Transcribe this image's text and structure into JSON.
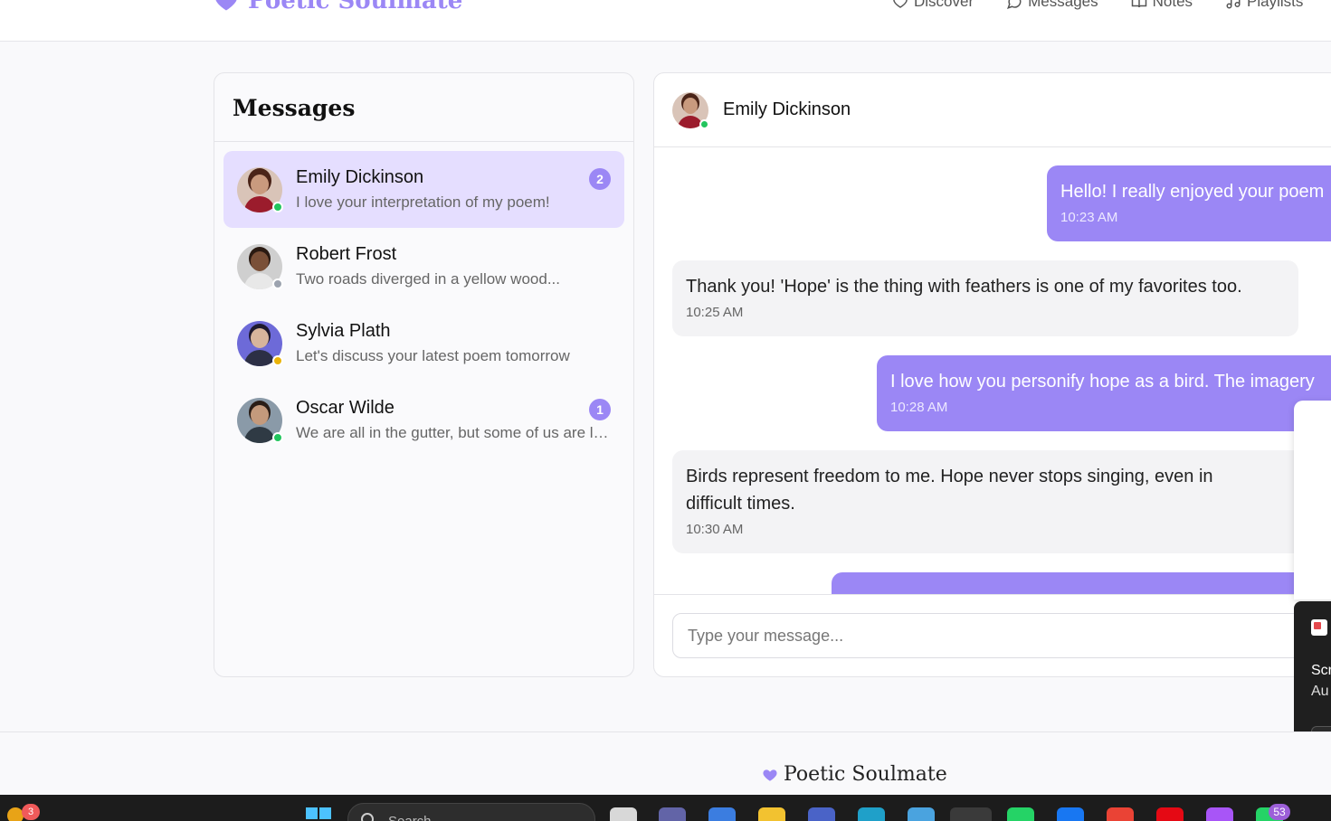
{
  "app": {
    "brand": "Poetic Soulmate",
    "accent_color": "#9b87f5"
  },
  "nav": {
    "links": [
      {
        "label": "Discover",
        "icon": "heart-icon"
      },
      {
        "label": "Messages",
        "icon": "message-circle-icon"
      },
      {
        "label": "Notes",
        "icon": "book-open-icon"
      },
      {
        "label": "Playlists",
        "icon": "music-icon"
      }
    ]
  },
  "messages_panel": {
    "title": "Messages",
    "conversations": [
      {
        "name": "Emily Dickinson",
        "preview": "I love your interpretation of my poem!",
        "unread": "2",
        "status": "online",
        "status_color": "#22c55e",
        "active": true
      },
      {
        "name": "Robert Frost",
        "preview": "Two roads diverged in a yellow wood...",
        "unread": "",
        "status": "offline",
        "status_color": "#9ca3af",
        "active": false
      },
      {
        "name": "Sylvia Plath",
        "preview": "Let's discuss your latest poem tomorrow",
        "unread": "",
        "status": "away",
        "status_color": "#eab308",
        "active": false
      },
      {
        "name": "Oscar Wilde",
        "preview": "We are all in the gutter, but some of us are looking at the stars",
        "unread": "1",
        "status": "online",
        "status_color": "#22c55e",
        "active": false
      }
    ]
  },
  "chat": {
    "contact_name": "Emily Dickinson",
    "contact_status_color": "#22c55e",
    "messages": [
      {
        "direction": "out",
        "text": "Hello! I really enjoyed your poem",
        "time": "10:23 AM"
      },
      {
        "direction": "in",
        "text": "Thank you! 'Hope' is the thing with feathers is one of my favorites too.",
        "time": "10:25 AM"
      },
      {
        "direction": "out",
        "text": "I love how you personify hope as a bird. The imagery",
        "time": "10:28 AM"
      },
      {
        "direction": "in",
        "text_line1": "Birds represent freedom to me. Hope never stops singing, even in",
        "text_line2": "difficult times.",
        "time": "10:30 AM"
      }
    ],
    "input_placeholder": "Type your message..."
  },
  "toast": {
    "line1": "Scr",
    "line2": "Au"
  },
  "footer": {
    "brand": "Poetic Soulmate"
  },
  "taskbar": {
    "warning_count": "3",
    "search_placeholder": "Search",
    "notification_count": "53"
  }
}
